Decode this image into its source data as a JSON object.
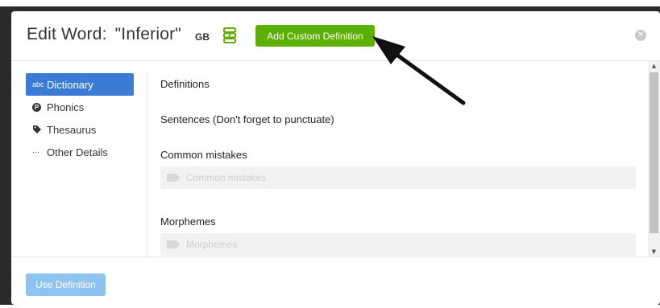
{
  "header": {
    "title_prefix": "Edit Word:",
    "word": "\"Inferior\"",
    "lang_code": "GB",
    "database_icon": "database-icon",
    "add_custom_definition_label": "Add Custom Definition",
    "close_icon": "close-icon"
  },
  "sidebar": {
    "items": [
      {
        "label": "Dictionary",
        "icon": "abc-icon",
        "icon_text": "abc",
        "active": true
      },
      {
        "label": "Phonics",
        "icon": "phonics-icon",
        "icon_text": "P",
        "active": false
      },
      {
        "label": "Thesaurus",
        "icon": "tag-icon",
        "icon_text": "",
        "active": false
      },
      {
        "label": "Other Details",
        "icon": "ellipsis-icon",
        "icon_text": "···",
        "active": false
      }
    ]
  },
  "main": {
    "definitions_label": "Definitions",
    "sentences_label": "Sentences (Don't forget to punctuate)",
    "common_mistakes_label": "Common mistakes",
    "common_mistakes_placeholder": "Common mistakes",
    "morphemes_label": "Morphemes",
    "morphemes_placeholder": "Morphemes"
  },
  "footer": {
    "use_definition_label": "Use Definition"
  },
  "colors": {
    "accent_green": "#5cb000",
    "active_blue": "#3a7bd5",
    "disabled_blue": "#8ec4ef"
  }
}
